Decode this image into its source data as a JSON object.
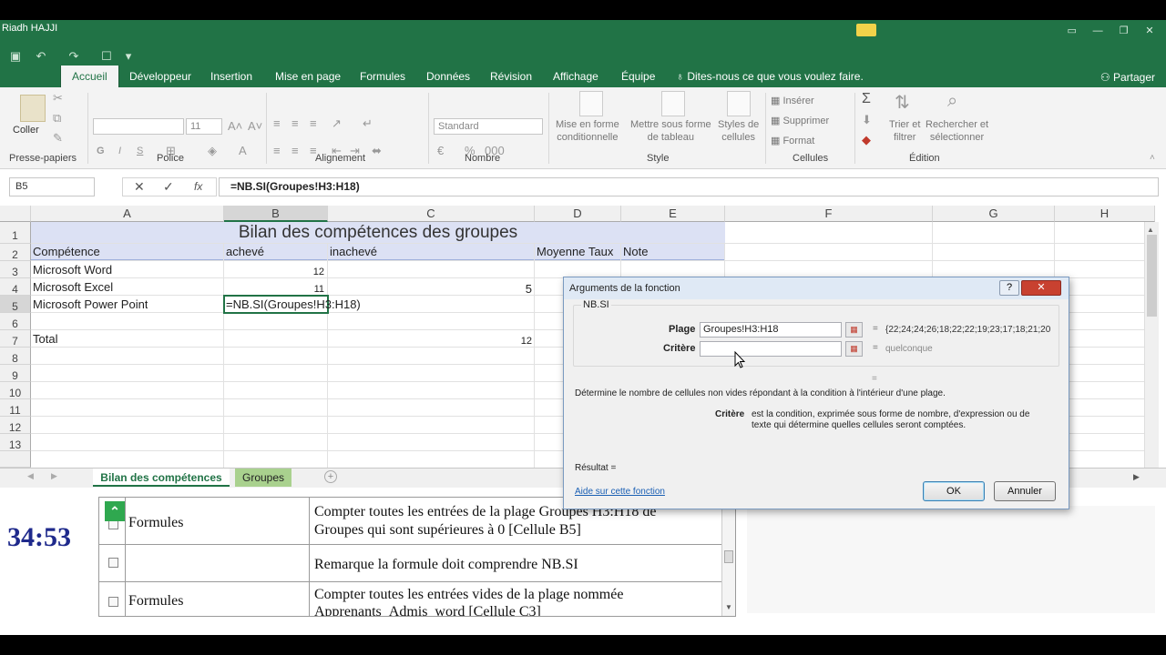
{
  "titlebar": {
    "user": "Riadh HAJJI"
  },
  "tabs": [
    "Accueil",
    "Développeur",
    "Insertion",
    "Mise en page",
    "Formules",
    "Données",
    "Révision",
    "Affichage",
    "Équipe"
  ],
  "tell_me": "Dites-nous ce que vous voulez faire.",
  "share": "Partager",
  "ribbon": {
    "paste_label": "Coller",
    "font_size": "11",
    "bold": "G",
    "italic": "I",
    "underline": "S",
    "number_format": "Standard",
    "mise_en_forme": [
      "Mise en forme",
      "conditionnelle"
    ],
    "mettre_tableau": [
      "Mettre sous forme",
      "de tableau"
    ],
    "styles_cellules": [
      "Styles de",
      "cellules"
    ],
    "inserer": "Insérer",
    "supprimer": "Supprimer",
    "format": "Format",
    "trier": [
      "Trier et",
      "filtrer"
    ],
    "rechercher": [
      "Rechercher et",
      "sélectionner"
    ],
    "groups": [
      "Presse-papiers",
      "Police",
      "Alignement",
      "Nombre",
      "Style",
      "Cellules",
      "Édition"
    ]
  },
  "formula_bar": {
    "name_box": "B5",
    "formula": "=NB.SI(Groupes!H3:H18)",
    "fx": "fx"
  },
  "columns": [
    "A",
    "B",
    "C",
    "D",
    "E",
    "F",
    "G",
    "H"
  ],
  "rows": [
    "1",
    "2",
    "3",
    "4",
    "5",
    "6",
    "7",
    "8",
    "9",
    "10",
    "11",
    "12",
    "13"
  ],
  "sheet": {
    "title": "Bilan des compétences des groupes",
    "headers": [
      "Compétence",
      "achevé",
      "inachevé",
      "Moyenne Taux",
      "Note"
    ],
    "rows": [
      {
        "a": "Microsoft Word",
        "b": "12",
        "c": ""
      },
      {
        "a": "Microsoft Excel",
        "b": "11",
        "c": "5"
      },
      {
        "a": "Microsoft Power Point",
        "b": "=NB.SI(Groupes!H3:H18)",
        "c": ""
      }
    ],
    "total_label": "Total",
    "total_c": "12"
  },
  "sheet_tabs": [
    "Bilan des compétences",
    "Groupes"
  ],
  "dialog": {
    "title": "Arguments de la fonction",
    "help": "?",
    "close": "✕",
    "function": "NB.SI",
    "plage_label": "Plage",
    "plage_value": "Groupes!H3:H18",
    "plage_result": "{22;24;24;26;18;22;22;19;23;17;18;21;20",
    "critere_label": "Critère",
    "critere_value": "",
    "critere_result": "quelconque",
    "eq": "=",
    "description": "Détermine le nombre de cellules non vides répondant à la condition à l'intérieur d'une plage.",
    "arg_name": "Critère",
    "arg_desc_1": "est la condition, exprimée sous forme de nombre, d'expression ou de",
    "arg_desc_2": "texte qui détermine quelles cellules seront comptées.",
    "result_label": "Résultat =",
    "help_link": "Aide sur cette fonction",
    "ok": "OK",
    "cancel": "Annuler"
  },
  "timer": "34:53",
  "tasks": [
    {
      "category": "Formules",
      "desc1": "Compter toutes les entrées de la plage Groupes H3:H18 de",
      "desc2": "Groupes qui sont supérieures à 0  [Cellule B5]"
    },
    {
      "category": "",
      "desc1": "Remarque la formule doit comprendre NB.SI",
      "desc2": ""
    },
    {
      "category": "Formules",
      "desc1": "Compter toutes les entrées vides de la plage nommée",
      "desc2": "Apprenants_Admis_word  [Cellule C3]"
    }
  ],
  "colors": {
    "excel_green": "#217346",
    "timer_blue": "#1f2a8c",
    "tab_green": "#a9d18e"
  }
}
